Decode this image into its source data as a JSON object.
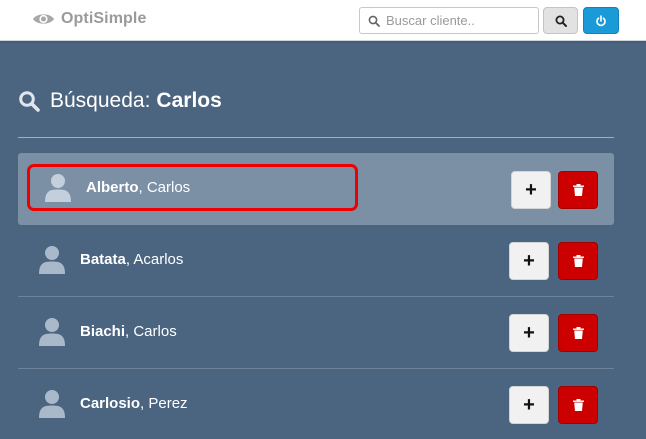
{
  "app": {
    "name": "OptiSimple"
  },
  "search": {
    "placeholder": "Buscar cliente.."
  },
  "heading": {
    "prefix": "Búsqueda:",
    "term": "Carlos"
  },
  "clients": [
    {
      "last": "Alberto",
      "first": ", Carlos"
    },
    {
      "last": "Batata",
      "first": ", Acarlos"
    },
    {
      "last": "Biachi",
      "first": ", Carlos"
    },
    {
      "last": "Carlosio",
      "first": ", Perez"
    }
  ],
  "actions": {
    "add_label": "+"
  },
  "colors": {
    "background": "#4b6480",
    "selected_row": "#7b8fa5",
    "delete": "#cc0000",
    "power": "#1a9ad6",
    "highlight": "#ee0000"
  },
  "icons": {
    "brand": "eye-icon",
    "search": "search-icon",
    "power": "power-icon",
    "avatar": "user-icon",
    "delete": "trash-icon"
  }
}
